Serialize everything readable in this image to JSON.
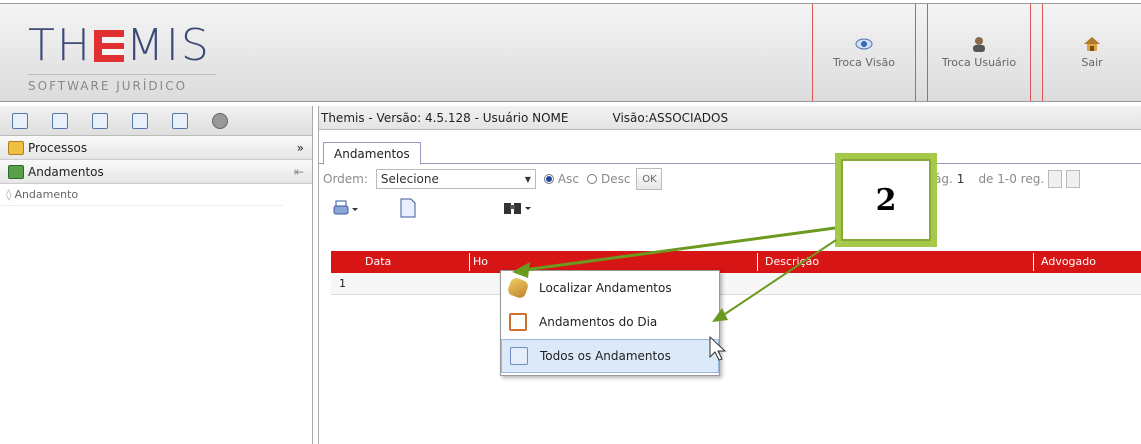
{
  "header": {
    "logo_main": "THEMIS",
    "logo_sub": "SOFTWARE JURÍDICO",
    "buttons": [
      {
        "label": "Troca Visão",
        "icon": "eye-icon"
      },
      {
        "label": "Troca Usuário",
        "icon": "user-icon"
      },
      {
        "label": "Sair",
        "icon": "home-icon"
      }
    ]
  },
  "sidebar": {
    "sections": [
      {
        "label": "Processos",
        "action": "»",
        "icon": "folder-icon"
      },
      {
        "label": "Andamentos",
        "action": "⇤",
        "icon": "andamentos-icon"
      }
    ],
    "sub_item": "Andamento"
  },
  "main": {
    "title_version": "Themis - Versão: 4.5.128 - Usuário NOME",
    "title_view": "Visão:ASSOCIADOS",
    "tab": "Andamentos",
    "order_label": "Ordem:",
    "order_value": "Selecione",
    "asc": "Asc",
    "desc": "Desc",
    "ok": "OK",
    "page": "ág.",
    "page_num": "1",
    "records": "de 1-0 reg.",
    "columns": [
      "Data",
      "Ho",
      "Descrição",
      "Advogado"
    ],
    "row_num": "1"
  },
  "menu": {
    "items": [
      {
        "label": "Localizar Andamentos",
        "icon": "search-pencil-icon"
      },
      {
        "label": "Andamentos do Dia",
        "icon": "calendar-icon"
      },
      {
        "label": "Todos os Andamentos",
        "icon": "list-icon"
      }
    ]
  },
  "callout": {
    "number": "2"
  },
  "colors": {
    "accent_red": "#d81515",
    "callout_green": "#a4c84a",
    "arrow_green": "#6b9a1f"
  }
}
